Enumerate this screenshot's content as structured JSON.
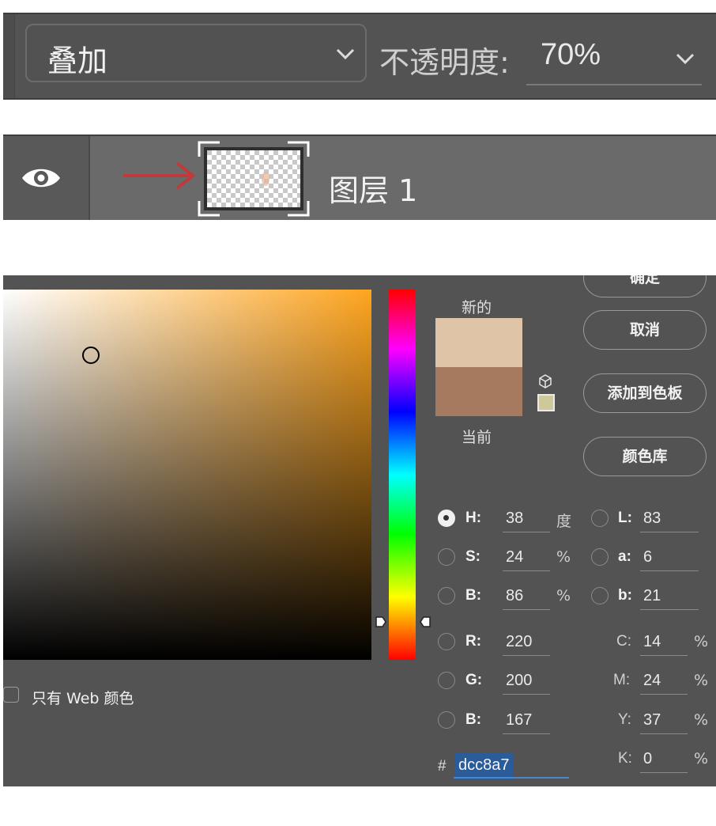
{
  "blend_bar": {
    "mode": "叠加",
    "opacity_label": "不透明度:",
    "opacity_value": "70%"
  },
  "layer": {
    "name": "图层 1"
  },
  "color_picker": {
    "new_label": "新的",
    "current_label": "当前",
    "new_color": "#e0c4a7",
    "current_color": "#a57a5f",
    "buttons": {
      "ok": "确定",
      "cancel": "取消",
      "add_to_swatches": "添加到色板",
      "color_libraries": "颜色库"
    },
    "fields": {
      "H": {
        "label": "H:",
        "value": "38",
        "unit": "度"
      },
      "S": {
        "label": "S:",
        "value": "24",
        "unit": "%"
      },
      "B": {
        "label": "B:",
        "value": "86",
        "unit": "%"
      },
      "R": {
        "label": "R:",
        "value": "220"
      },
      "G": {
        "label": "G:",
        "value": "200"
      },
      "Bl": {
        "label": "B:",
        "value": "167"
      },
      "L": {
        "label": "L:",
        "value": "83"
      },
      "a": {
        "label": "a:",
        "value": "6"
      },
      "b": {
        "label": "b:",
        "value": "21"
      },
      "C": {
        "label": "C:",
        "value": "14",
        "unit": "%"
      },
      "M": {
        "label": "M:",
        "value": "24",
        "unit": "%"
      },
      "Y": {
        "label": "Y:",
        "value": "37",
        "unit": "%"
      },
      "K": {
        "label": "K:",
        "value": "0",
        "unit": "%"
      }
    },
    "hex_hash": "#",
    "hex_value": "dcc8a7",
    "web_only_label": "只有 Web 颜色"
  }
}
